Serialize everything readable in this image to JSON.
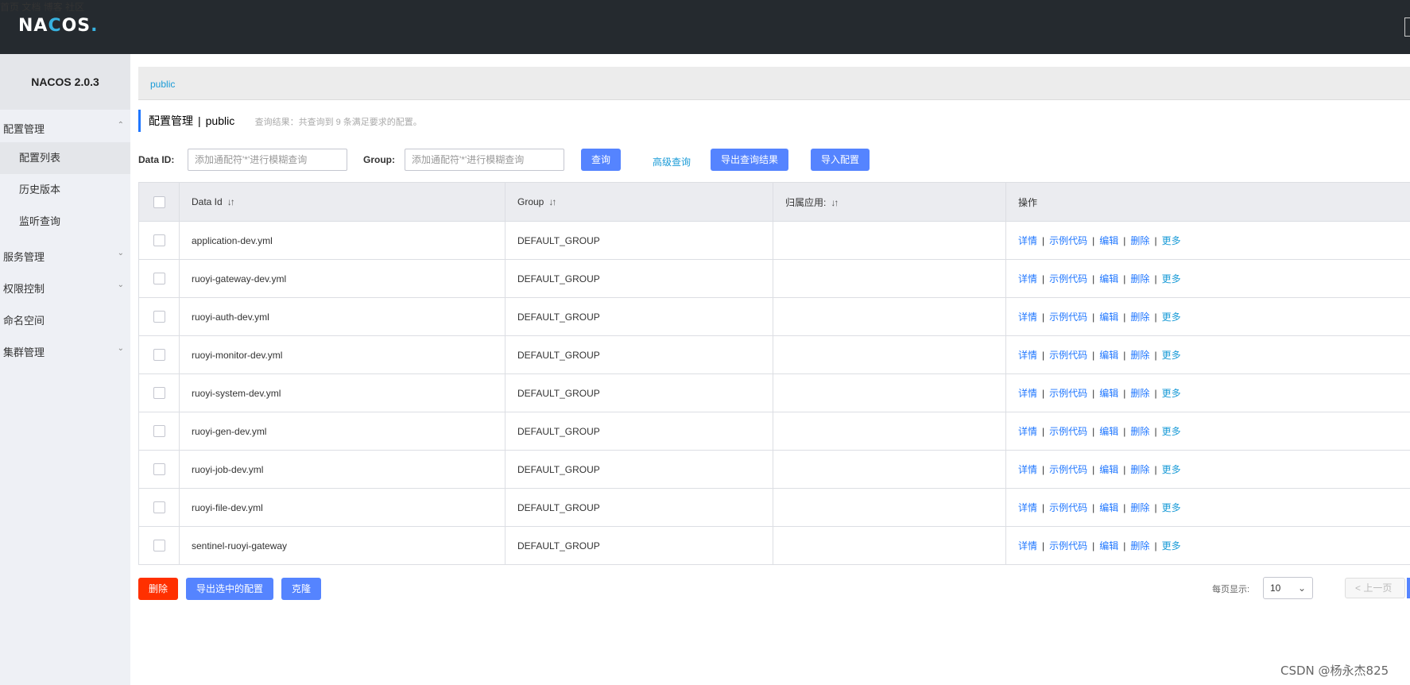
{
  "header": {
    "logo_pre": "NA",
    "logo_o": "C",
    "logo_post": "OS",
    "logo_dot": ".",
    "nav": [
      "首页",
      "文档",
      "博客",
      "社区"
    ]
  },
  "sidebar": {
    "version": "NACOS 2.0.3",
    "menus": [
      {
        "label": "配置管理",
        "arrow": "⌃"
      },
      {
        "label": "服务管理",
        "arrow": "⌄"
      },
      {
        "label": "权限控制",
        "arrow": "⌄"
      },
      {
        "label": "命名空间",
        "arrow": ""
      },
      {
        "label": "集群管理",
        "arrow": "⌄"
      }
    ],
    "sub_items": [
      "配置列表",
      "历史版本",
      "监听查询"
    ]
  },
  "breadcrumb": {
    "namespace": "public"
  },
  "page_title": {
    "main": "配置管理",
    "separator": "|",
    "namespace": "public",
    "hint": "查询结果：共查询到 9 条满足要求的配置。"
  },
  "search": {
    "dataid_label": "Data ID:",
    "dataid_placeholder": "添加通配符'*'进行模糊查询",
    "group_label": "Group:",
    "group_placeholder": "添加通配符'*'进行模糊查询",
    "query_button": "查询",
    "advanced_link": "高级查询",
    "export_results_button": "导出查询结果",
    "import_button": "导入配置"
  },
  "table": {
    "columns": [
      "Data Id",
      "Group",
      "归属应用:",
      "操作"
    ],
    "sort_icon": "↓↑",
    "rows": [
      {
        "data_id": "application-dev.yml",
        "group": "DEFAULT_GROUP",
        "app": ""
      },
      {
        "data_id": "ruoyi-gateway-dev.yml",
        "group": "DEFAULT_GROUP",
        "app": ""
      },
      {
        "data_id": "ruoyi-auth-dev.yml",
        "group": "DEFAULT_GROUP",
        "app": ""
      },
      {
        "data_id": "ruoyi-monitor-dev.yml",
        "group": "DEFAULT_GROUP",
        "app": ""
      },
      {
        "data_id": "ruoyi-system-dev.yml",
        "group": "DEFAULT_GROUP",
        "app": ""
      },
      {
        "data_id": "ruoyi-gen-dev.yml",
        "group": "DEFAULT_GROUP",
        "app": ""
      },
      {
        "data_id": "ruoyi-job-dev.yml",
        "group": "DEFAULT_GROUP",
        "app": ""
      },
      {
        "data_id": "ruoyi-file-dev.yml",
        "group": "DEFAULT_GROUP",
        "app": ""
      },
      {
        "data_id": "sentinel-ruoyi-gateway",
        "group": "DEFAULT_GROUP",
        "app": ""
      }
    ],
    "ops": {
      "detail": "详情",
      "sample": "示例代码",
      "edit": "编辑",
      "delete": "删除",
      "more": "更多",
      "sep": "|"
    }
  },
  "bottom": {
    "delete_button": "删除",
    "export_selected_button": "导出选中的配置",
    "clone_button": "克隆",
    "page_size_label": "每页显示:",
    "page_size_value": "10",
    "prev_button": "< 上一页"
  },
  "watermark": "CSDN @杨永杰825",
  "colors": {
    "primary": "#5584ff",
    "danger": "#ff3000",
    "topbar": "#252a2f",
    "link": "#2077ff"
  }
}
